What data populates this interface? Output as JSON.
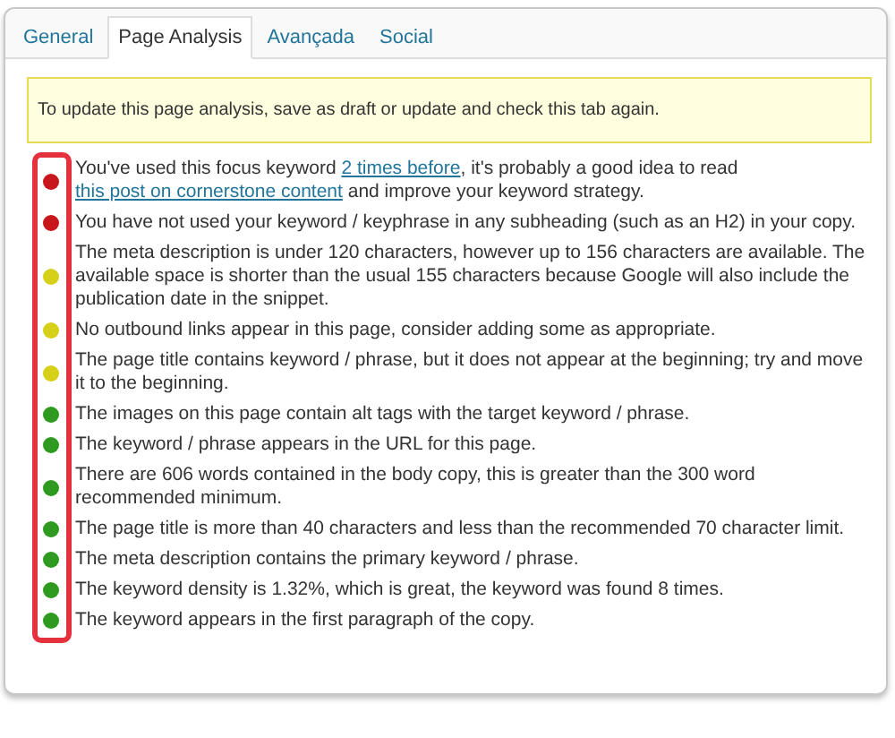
{
  "tabs": [
    {
      "label": "General",
      "selected": false
    },
    {
      "label": "Page Analysis",
      "selected": true
    },
    {
      "label": "Avançada",
      "selected": false
    },
    {
      "label": "Social",
      "selected": false
    }
  ],
  "notice": "To update this page analysis, save as draft or update and check this tab again.",
  "results": [
    {
      "color": "#c8161d",
      "parts": [
        {
          "kind": "text",
          "text": "You've used this focus keyword "
        },
        {
          "kind": "link",
          "text": "2 times before"
        },
        {
          "kind": "text",
          "text": ", it's probably a good idea to read "
        },
        {
          "kind": "link",
          "text": "this post on cornerstone content"
        },
        {
          "kind": "text",
          "text": " and improve your keyword strategy."
        }
      ]
    },
    {
      "color": "#c8161d",
      "parts": [
        {
          "kind": "text",
          "text": "You have not used your keyword / keyphrase in any subheading (such as an H2) in your copy."
        }
      ]
    },
    {
      "color": "#d6d019",
      "parts": [
        {
          "kind": "text",
          "text": "The meta description is under 120 characters, however up to 156 characters are available. The available space is shorter than the usual 155 characters because Google will also include the publication date in the snippet."
        }
      ]
    },
    {
      "color": "#d6d019",
      "parts": [
        {
          "kind": "text",
          "text": "No outbound links appear in this page, consider adding some as appropriate."
        }
      ]
    },
    {
      "color": "#d6d019",
      "parts": [
        {
          "kind": "text",
          "text": "The page title contains keyword / phrase, but it does not appear at the beginning; try and move it to the beginning."
        }
      ]
    },
    {
      "color": "#2e9a1f",
      "parts": [
        {
          "kind": "text",
          "text": "The images on this page contain alt tags with the target keyword / phrase."
        }
      ]
    },
    {
      "color": "#2e9a1f",
      "parts": [
        {
          "kind": "text",
          "text": "The keyword / phrase appears in the URL for this page."
        }
      ]
    },
    {
      "color": "#2e9a1f",
      "parts": [
        {
          "kind": "text",
          "text": "There are 606 words contained in the body copy, this is greater than the 300 word recommended minimum."
        }
      ]
    },
    {
      "color": "#2e9a1f",
      "parts": [
        {
          "kind": "text",
          "text": "The page title is more than 40 characters and less than the recommended 70 character limit."
        }
      ]
    },
    {
      "color": "#2e9a1f",
      "parts": [
        {
          "kind": "text",
          "text": "The meta description contains the primary keyword / phrase."
        }
      ]
    },
    {
      "color": "#2e9a1f",
      "parts": [
        {
          "kind": "text",
          "text": "The keyword density is 1.32%, which is great, the keyword was found 8 times."
        }
      ]
    },
    {
      "color": "#2e9a1f",
      "parts": [
        {
          "kind": "text",
          "text": "The keyword appears in the first paragraph of the copy."
        }
      ]
    }
  ]
}
